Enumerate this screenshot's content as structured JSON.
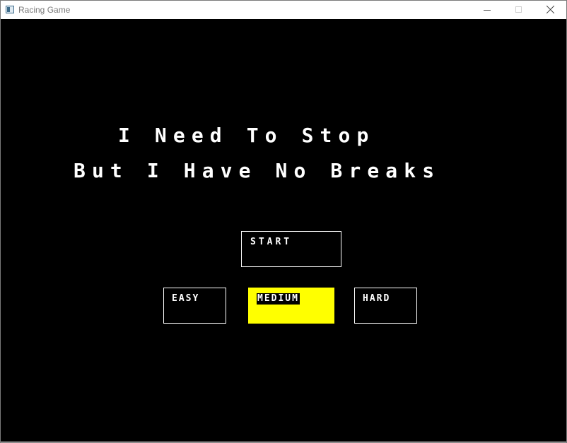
{
  "window": {
    "title": "Racing Game",
    "controls": {
      "minimize_icon": "minimize-icon",
      "maximize_icon": "maximize-icon",
      "close_icon": "close-icon"
    }
  },
  "game": {
    "background_color": "#000000",
    "title_lines": [
      "I Need To Stop",
      "But I Have No Breaks"
    ],
    "start_label": "START",
    "difficulty": {
      "options": [
        "EASY",
        "MEDIUM",
        "HARD"
      ],
      "selected": "MEDIUM",
      "selected_color": "#ffff00"
    }
  }
}
